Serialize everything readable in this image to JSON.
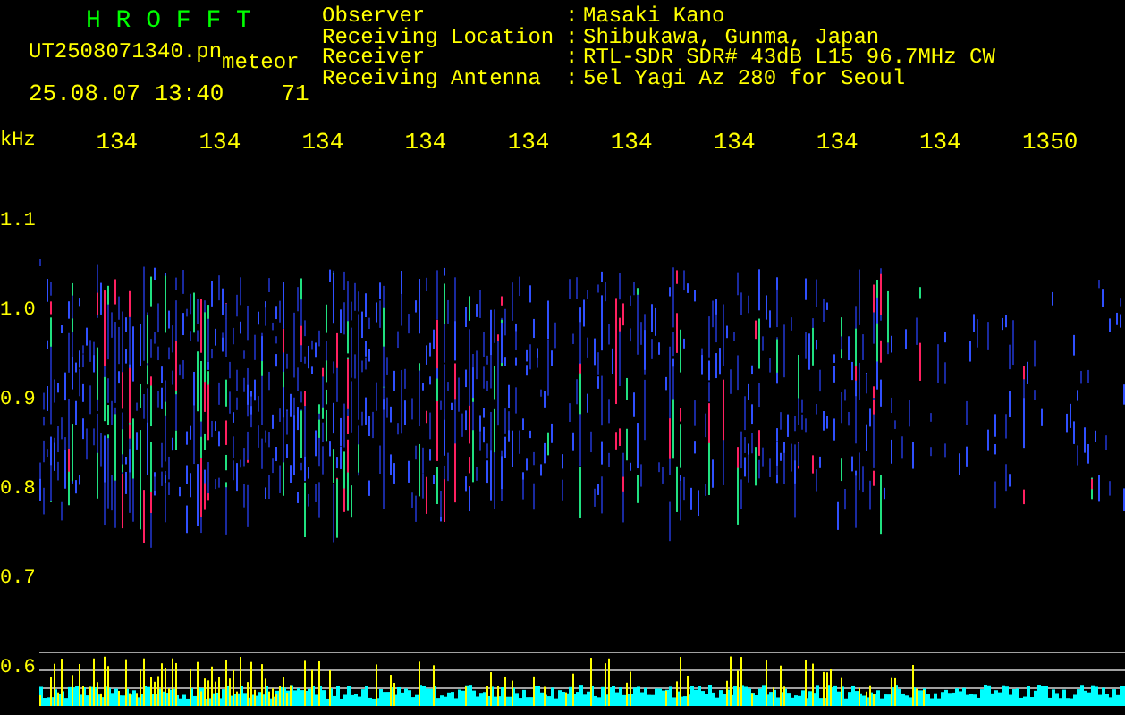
{
  "header": {
    "title": "H R O F F T",
    "file_name": "UT2508071340.pn",
    "mode": "meteor",
    "timestamp": "25.08.07 13:40",
    "count": "71"
  },
  "info": [
    {
      "label": "Observer",
      "separator": ":",
      "value": "Masaki Kano"
    },
    {
      "label": "Receiving Location",
      "separator": ":",
      "value": "Shibukawa, Gunma, Japan"
    },
    {
      "label": "Receiver",
      "separator": ":",
      "value": "RTL-SDR SDR# 43dB L15 96.7MHz CW"
    },
    {
      "label": "Receiving Antenna",
      "separator": ":",
      "value": "5el Yagi Az 280 for Seoul"
    }
  ],
  "x_axis": {
    "unit": "kHz",
    "ticks": [
      "134",
      "134",
      "134",
      "134",
      "134",
      "134",
      "134",
      "134",
      "134",
      "1350"
    ]
  },
  "y_axis": {
    "ticks": [
      "1.1",
      "1.0",
      "0.9",
      "0.8",
      "0.7",
      "0.6"
    ]
  }
}
